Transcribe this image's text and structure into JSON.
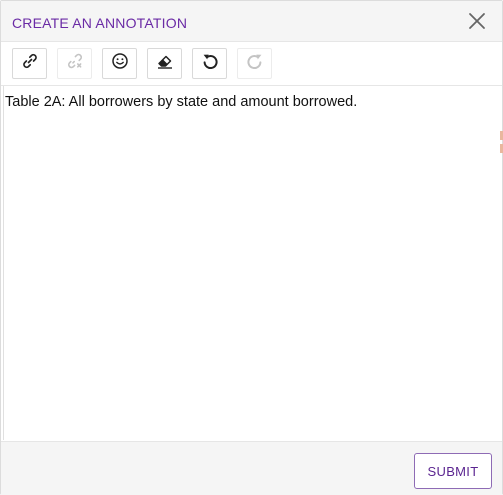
{
  "dialog": {
    "title": "CREATE AN ANNOTATION",
    "close_icon": "close-icon"
  },
  "toolbar": {
    "buttons": [
      {
        "name": "link",
        "icon": "link-icon",
        "enabled": true
      },
      {
        "name": "unlink",
        "icon": "unlink-icon",
        "enabled": false
      },
      {
        "name": "emoji",
        "icon": "smiley-icon",
        "enabled": true
      },
      {
        "name": "eraser",
        "icon": "eraser-icon",
        "enabled": true
      },
      {
        "name": "undo",
        "icon": "undo-icon",
        "enabled": true
      },
      {
        "name": "redo",
        "icon": "redo-icon",
        "enabled": false
      }
    ]
  },
  "editor": {
    "content": "Table 2A: All borrowers by state and amount borrowed."
  },
  "footer": {
    "submit_label": "SUBMIT"
  },
  "colors": {
    "accent": "#6a2aa5",
    "header_bg": "#f5f5f5",
    "border": "#dcdcdc",
    "disabled_icon": "#c4c4c4"
  }
}
